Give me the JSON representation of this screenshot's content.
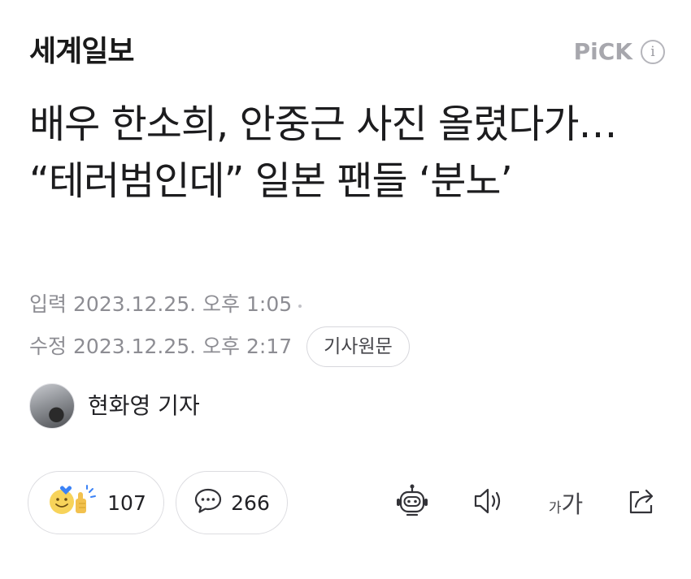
{
  "press": {
    "name": "세계일보"
  },
  "pick": {
    "label": "PiCK",
    "info_glyph": "i"
  },
  "headline": {
    "text": "배우 한소희, 안중근 사진 올렸다가… “테러범인데” 일본 팬들 ‘분노’"
  },
  "meta": {
    "input_label": "입력",
    "input_datetime": "2023.12.25. 오후 1:05",
    "edit_label": "수정",
    "edit_datetime": "2023.12.25. 오후 2:17",
    "original_button": "기사원문"
  },
  "reporter": {
    "name": "현화영 기자"
  },
  "actions": {
    "reaction_count": "107",
    "comment_count": "266",
    "font_small": "가",
    "font_big": "가"
  },
  "icons": {
    "info": "info-icon",
    "reaction": "reaction-emoji-icon",
    "comment": "speech-bubble-icon",
    "bot": "robot-summary-icon",
    "audio": "speaker-icon",
    "font": "font-size-icon",
    "share": "share-icon"
  },
  "colors": {
    "text": "#1c1c1e",
    "meta": "#8d8d93",
    "pick": "#a7a7ad",
    "border": "#dcdce0",
    "reaction_yellow": "#f7d35a",
    "reaction_blue": "#3b82f6"
  }
}
